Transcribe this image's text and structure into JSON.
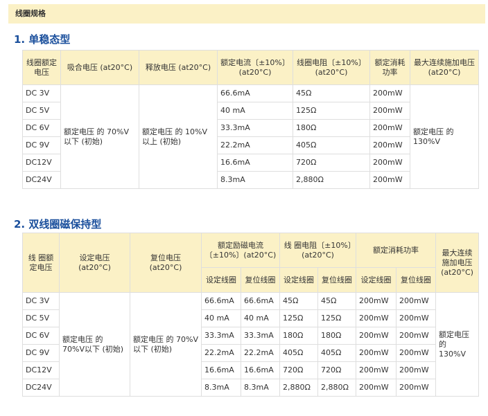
{
  "section_header": "线圈规格",
  "single": {
    "heading": "1. 单稳态型",
    "headers": {
      "coil_voltage": "线圈额定电压",
      "pickup": "吸合电压 (at20°C)",
      "release": "释放电压 (at20°C)",
      "current": "额定电流〔±10%〕(at20°C)",
      "resistance": "线圈电阻〔±10%〕(at20°C)",
      "power": "额定消耗功率",
      "max_voltage": "最大连续施加电压 (at20°C)"
    },
    "pickup_value": "额定电压 的 70%V 以下 (初始)",
    "release_value": "额定电压 的 10%V 以上 (初始)",
    "max_value": "额定电压 的 130%V",
    "rows": [
      {
        "voltage": "DC 3V",
        "current": "66.6mA",
        "resistance": "45Ω",
        "power": "200mW"
      },
      {
        "voltage": "DC 5V",
        "current": "40 mA",
        "resistance": "125Ω",
        "power": "200mW"
      },
      {
        "voltage": "DC 6V",
        "current": "33.3mA",
        "resistance": "180Ω",
        "power": "200mW"
      },
      {
        "voltage": "DC 9V",
        "current": "22.2mA",
        "resistance": "405Ω",
        "power": "200mW"
      },
      {
        "voltage": "DC12V",
        "current": "16.6mA",
        "resistance": "720Ω",
        "power": "200mW"
      },
      {
        "voltage": "DC24V",
        "current": "8.3mA",
        "resistance": "2,880Ω",
        "power": "200mW"
      }
    ]
  },
  "dual": {
    "heading": "2. 双线圈磁保持型",
    "headers": {
      "coil_voltage": "线 圈额定电压",
      "set_voltage": "设定电压 (at20°C)",
      "reset_voltage": "复位电压 (at20°C)",
      "current": "额定励磁电流〔±10%〕(at20°C)",
      "resistance": "线 圈电阻〔±10%〕(at20°C)",
      "power": "额定消耗功率",
      "max_voltage": "最大连续 施加电压(at20°C)",
      "set_coil": "设定线圈",
      "reset_coil": "复位线圈"
    },
    "set_value": "额定电压 的 70%V以下 (初始)",
    "reset_value": "额定电压 的 70%V以下 (初始)",
    "max_value": "额定电压的 130%V",
    "rows": [
      {
        "voltage": "DC 3V",
        "current_set": "66.6mA",
        "current_reset": "66.6mA",
        "res_set": "45Ω",
        "res_reset": "45Ω",
        "power_set": "200mW",
        "power_reset": "200mW"
      },
      {
        "voltage": "DC 5V",
        "current_set": "40 mA",
        "current_reset": "40 mA",
        "res_set": "125Ω",
        "res_reset": "125Ω",
        "power_set": "200mW",
        "power_reset": "200mW"
      },
      {
        "voltage": "DC 6V",
        "current_set": "33.3mA",
        "current_reset": "33.3mA",
        "res_set": "180Ω",
        "res_reset": "180Ω",
        "power_set": "200mW",
        "power_reset": "200mW"
      },
      {
        "voltage": "DC 9V",
        "current_set": "22.2mA",
        "current_reset": "22.2mA",
        "res_set": "405Ω",
        "res_reset": "405Ω",
        "power_set": "200mW",
        "power_reset": "200mW"
      },
      {
        "voltage": "DC12V",
        "current_set": "16.6mA",
        "current_reset": "16.6mA",
        "res_set": "720Ω",
        "res_reset": "720Ω",
        "power_set": "200mW",
        "power_reset": "200mW"
      },
      {
        "voltage": "DC24V",
        "current_set": "8.3mA",
        "current_reset": "8.3mA",
        "res_set": "2,880Ω",
        "res_reset": "2,880Ω",
        "power_set": "200mW",
        "power_reset": "200mW"
      }
    ]
  }
}
